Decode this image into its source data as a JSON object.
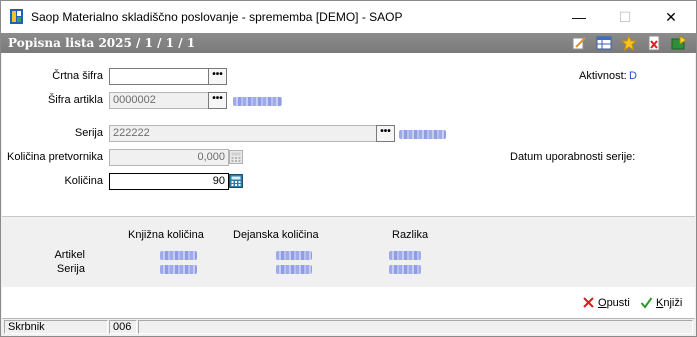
{
  "window": {
    "title": "Saop Materialno skladiščno poslovanje - sprememba [DEMO] - SAOP",
    "minimize": "—",
    "maximize": "☐",
    "close": "✕"
  },
  "header": {
    "title": "Popisna lista 2025 / 1 / 1 / 1",
    "icons": [
      "edit-icon",
      "grid-icon",
      "favorite-star-icon",
      "delete-icon",
      "export-icon"
    ]
  },
  "form": {
    "crtna_sifra": {
      "label": "Črtna šifra",
      "value": "",
      "lookup": "•••"
    },
    "sifra_artikla": {
      "label": "Šifra artikla",
      "value": "0000002",
      "lookup": "•••"
    },
    "serija": {
      "label": "Serija",
      "value": "222222",
      "lookup": "•••"
    },
    "kolicina_pretvornika": {
      "label": "Količina pretvornika",
      "value": "0,000"
    },
    "kolicina": {
      "label": "Količina",
      "value": "90"
    },
    "aktivnost": {
      "label": "Aktivnost:",
      "value": "D"
    },
    "datum_uporabnosti": {
      "label": "Datum uporabnosti serije:"
    }
  },
  "summary": {
    "columns": [
      "Knjižna količina",
      "Dejanska količina",
      "Razlika"
    ],
    "rows": [
      "Artikel",
      "Serija"
    ]
  },
  "actions": {
    "cancel_prefix": "O",
    "cancel_rest": "pusti",
    "post_prefix": "K",
    "post_rest": "njiži"
  },
  "status": {
    "user": "Skrbnik",
    "code": "006"
  },
  "colors": {
    "header_bg": "#7f7f7f",
    "accent_blue": "#2a4bd0",
    "cancel_red": "#d61f1f",
    "post_green": "#2f9a2f"
  }
}
